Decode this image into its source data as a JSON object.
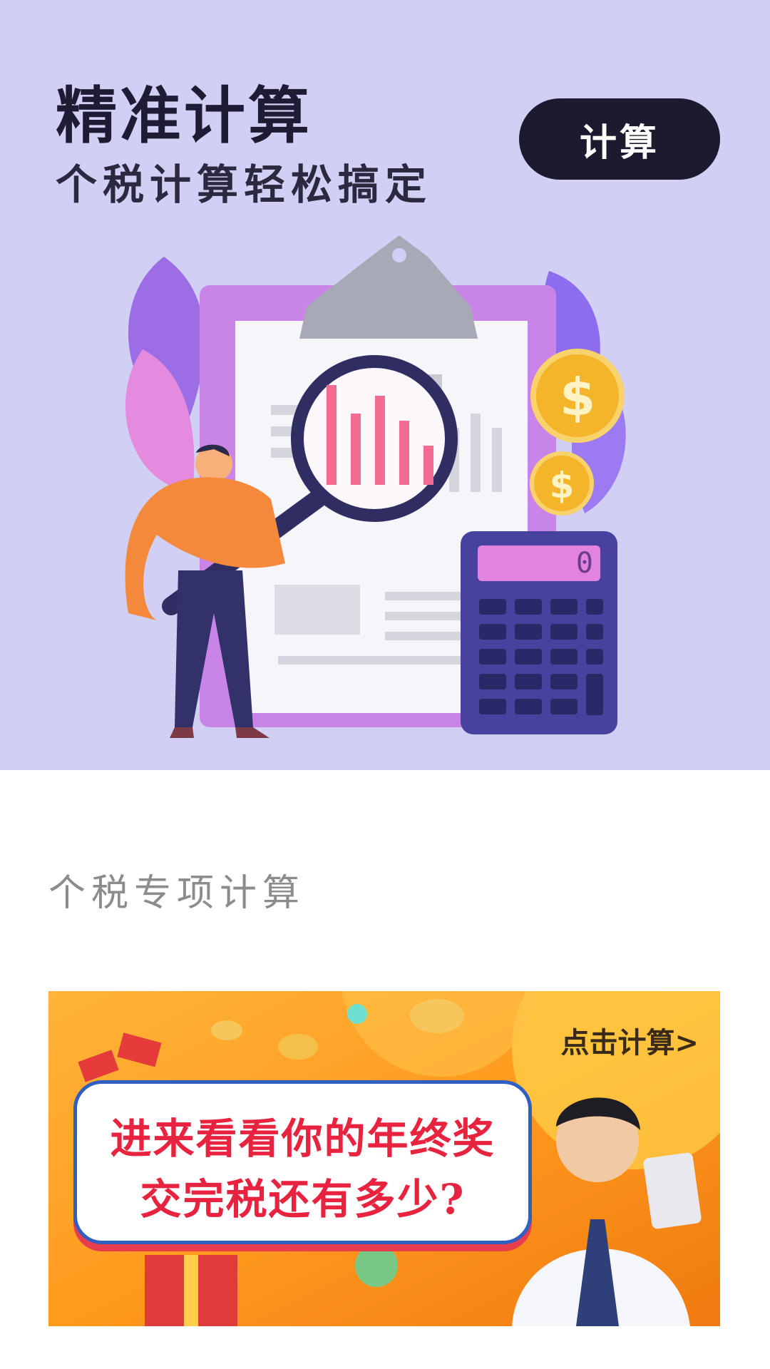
{
  "hero": {
    "title": "精准计算",
    "subtitle": "个税计算轻松搞定",
    "calc_button": "计算",
    "calculator_display": "0"
  },
  "section": {
    "title": "个税专项计算"
  },
  "banner": {
    "link_text": "点击计算>",
    "headline_line1": "进来看看你的年终奖",
    "headline_line2": "交完税还有多少?"
  },
  "colors": {
    "hero_bg": "#d1cff3",
    "button_bg": "#1b1a2e",
    "banner_accent": "#e8233f"
  }
}
